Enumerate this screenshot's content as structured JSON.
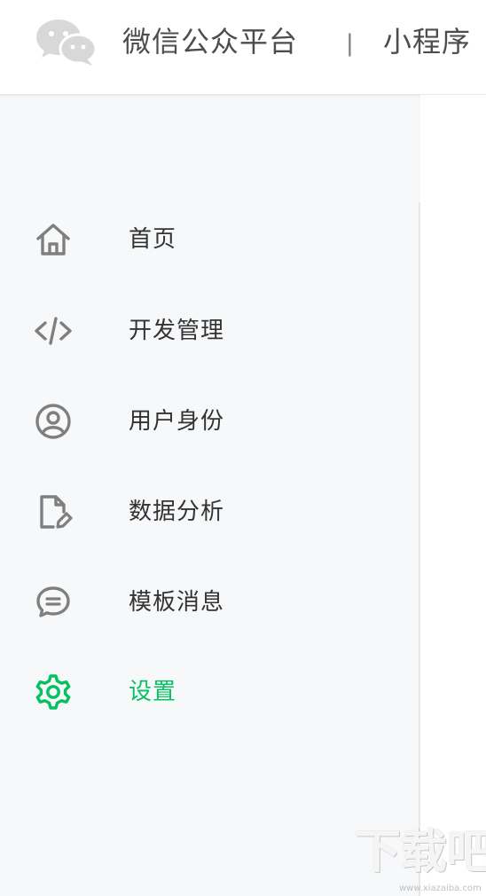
{
  "header": {
    "brand": "微信公众平台",
    "divider": "|",
    "product": "小程序"
  },
  "sidebar": {
    "items": [
      {
        "label": "首页",
        "icon": "home-icon",
        "active": false
      },
      {
        "label": "开发管理",
        "icon": "code-icon",
        "active": false
      },
      {
        "label": "用户身份",
        "icon": "user-circle-icon",
        "active": false
      },
      {
        "label": "数据分析",
        "icon": "document-edit-icon",
        "active": false
      },
      {
        "label": "模板消息",
        "icon": "message-bubble-icon",
        "active": false
      },
      {
        "label": "设置",
        "icon": "gear-icon",
        "active": true
      }
    ]
  },
  "colors": {
    "accent": "#07c160",
    "text": "#333333",
    "icon": "#7f7f7f",
    "sidebar_bg": "#f7f8fa",
    "header_bg": "#ffffff"
  }
}
